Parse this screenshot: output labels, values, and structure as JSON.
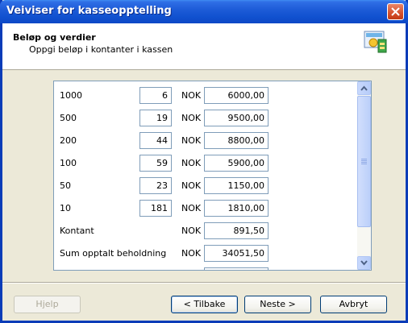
{
  "window": {
    "title": "Veiviser for kasseopptelling"
  },
  "header": {
    "title": "Beløp og verdier",
    "subtitle": "Oppgi beløp i kontanter i kassen"
  },
  "rows": [
    {
      "label": "1000",
      "count": "6",
      "currency": "NOK",
      "amount": "6000,00"
    },
    {
      "label": "500",
      "count": "19",
      "currency": "NOK",
      "amount": "9500,00"
    },
    {
      "label": "200",
      "count": "44",
      "currency": "NOK",
      "amount": "8800,00"
    },
    {
      "label": "100",
      "count": "59",
      "currency": "NOK",
      "amount": "5900,00"
    },
    {
      "label": "50",
      "count": "23",
      "currency": "NOK",
      "amount": "1150,00"
    },
    {
      "label": "10",
      "count": "181",
      "currency": "NOK",
      "amount": "1810,00"
    },
    {
      "label": "Kontant",
      "currency": "NOK",
      "amount": "891,50"
    },
    {
      "label": "Sum opptalt beholdning",
      "currency": "NOK",
      "amount": "34051,50"
    }
  ],
  "buttons": {
    "help": "Hjelp",
    "back": "< Tilbake",
    "next": "Neste >",
    "cancel": "Avbryt"
  }
}
